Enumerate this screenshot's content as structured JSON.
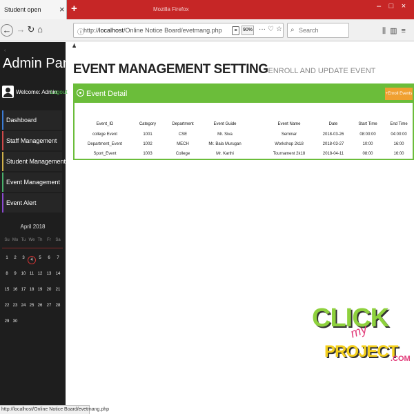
{
  "browser": {
    "tab_title": "Student open",
    "window_title": "Mozilla Firefox",
    "url_prefix": "http://",
    "url_host": "localhost",
    "url_path": "/Online Notice Board/evetmang.php",
    "zoom": "90%",
    "search_placeholder": "Search",
    "status_url": "http://localhost/Online Notice Board/evetmang.php"
  },
  "sidebar": {
    "title": "Admin Panel",
    "welcome": "Welcome: Admin",
    "logout": "Logout",
    "items": [
      {
        "label": "Dashboard"
      },
      {
        "label": "Staff Management"
      },
      {
        "label": "Student Management"
      },
      {
        "label": "Event Management"
      },
      {
        "label": "Event Alert"
      }
    ]
  },
  "calendar": {
    "month": "April 2018",
    "weekdays": [
      "Su",
      "Mo",
      "Tu",
      "We",
      "Th",
      "Fr",
      "Sa"
    ],
    "today": "4",
    "weeks": [
      [
        "1",
        "2",
        "3",
        "4",
        "5",
        "6",
        "7"
      ],
      [
        "8",
        "9",
        "10",
        "11",
        "12",
        "13",
        "14"
      ],
      [
        "15",
        "16",
        "17",
        "18",
        "19",
        "20",
        "21"
      ],
      [
        "22",
        "23",
        "24",
        "25",
        "26",
        "27",
        "28"
      ],
      [
        "29",
        "30"
      ]
    ]
  },
  "main": {
    "title": "EVENT MANAGEMENT SETTING",
    "subtitle": "ENROLL AND UPDATE EVENT",
    "panel_title": "Event Detail",
    "enroll_button": "+Enroll Events",
    "table": {
      "headers": [
        "Event_ID",
        "Category",
        "Department",
        "Event Guide",
        "Event Name",
        "Date",
        "Start Time",
        "End Time"
      ],
      "rows": [
        [
          "college Event",
          "1001",
          "CSE",
          "Mr. Siva",
          "Seminar",
          "2018-03-26",
          "08:00:00",
          "04:00:00"
        ],
        [
          "Department_Event",
          "1002",
          "MECH",
          "Mr. Bala Murugan",
          "Workshop 2k18",
          "2018-03-27",
          "10:00",
          "16:00"
        ],
        [
          "Sport_Event",
          "1003",
          "College",
          "Mr. Karthi",
          "Tournament 2k18",
          "2018-04-11",
          "08:00",
          "16:00"
        ]
      ]
    }
  },
  "logo": {
    "click": "CLICK",
    "my": "my",
    "project": "PROJECT",
    "com": ".COM"
  }
}
